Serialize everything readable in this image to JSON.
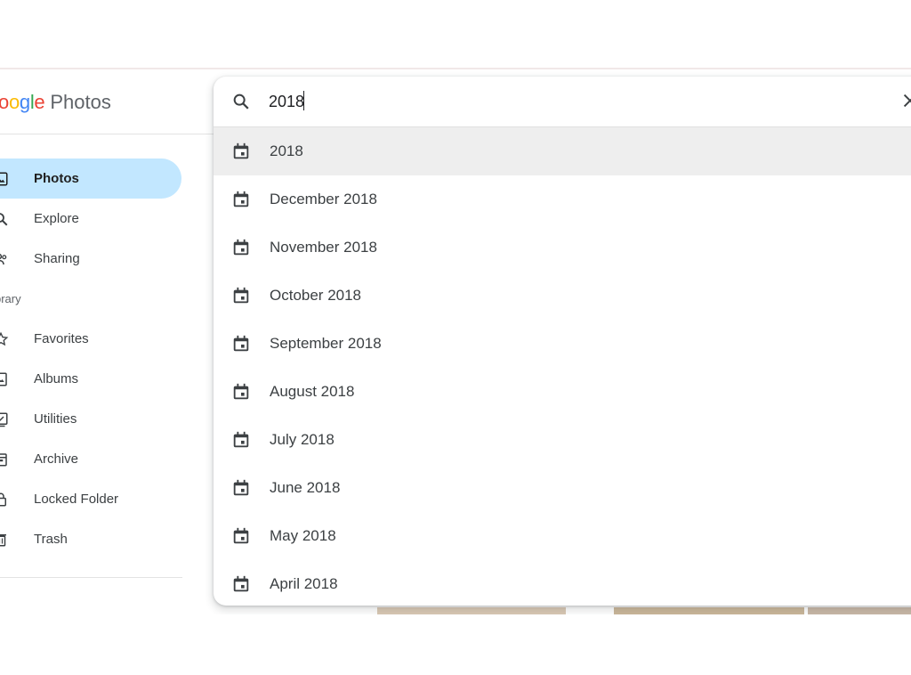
{
  "app": {
    "logo_parts": [
      "o",
      "o",
      "g",
      "l",
      "e"
    ],
    "product": "Photos"
  },
  "sidebar": {
    "items": [
      {
        "label": "Photos",
        "icon": "photo-icon",
        "active": true
      },
      {
        "label": "Explore",
        "icon": "search-icon",
        "active": false
      },
      {
        "label": "Sharing",
        "icon": "people-icon",
        "active": false
      }
    ],
    "library_label": "brary",
    "library_items": [
      {
        "label": "Favorites",
        "icon": "star-icon"
      },
      {
        "label": "Albums",
        "icon": "album-icon"
      },
      {
        "label": "Utilities",
        "icon": "utilities-icon"
      },
      {
        "label": "Archive",
        "icon": "archive-icon"
      },
      {
        "label": "Locked Folder",
        "icon": "lock-icon"
      },
      {
        "label": "Trash",
        "icon": "trash-icon"
      }
    ]
  },
  "search": {
    "query": "2018",
    "suggestions": [
      "2018",
      "December 2018",
      "November 2018",
      "October 2018",
      "September 2018",
      "August 2018",
      "July 2018",
      "June 2018",
      "May 2018",
      "April 2018"
    ],
    "suggestion_icon": "calendar-icon"
  },
  "colors": {
    "active_nav_bg": "#c2e7ff",
    "highlight_row_bg": "#eeeeee",
    "text": "#3c4043"
  }
}
